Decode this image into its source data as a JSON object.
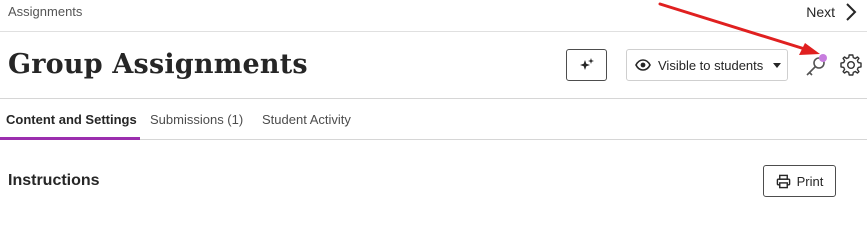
{
  "breadcrumb": {
    "label": "Assignments"
  },
  "nav": {
    "next_label": "Next"
  },
  "header": {
    "title": "Group Assignments",
    "visibility_label": "Visible to students"
  },
  "tabs": [
    {
      "label": "Content and Settings",
      "active": true
    },
    {
      "label": "Submissions (1)",
      "active": false
    },
    {
      "label": "Student Activity",
      "active": false
    }
  ],
  "content": {
    "section_heading": "Instructions",
    "print_label": "Print"
  },
  "icons": {
    "next": "chevron-right-icon",
    "ai_assist": "sparkle-icon",
    "visibility": "eye-icon",
    "dropdown": "caret-down-icon",
    "key": "key-icon",
    "settings": "gear-icon",
    "print": "printer-icon"
  },
  "colors": {
    "accent": "#9b2fae",
    "annotation_arrow": "#e02020",
    "notification_dot": "#c77dde"
  }
}
